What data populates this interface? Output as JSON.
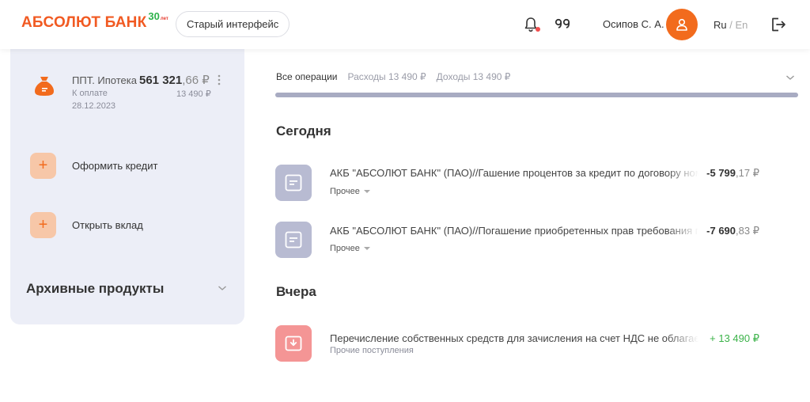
{
  "header": {
    "logo_text": "АБСОЛЮТ БАНК",
    "logo_badge": "30",
    "logo_badge_suffix": "лет",
    "old_ui_label": "Старый интерфейс",
    "user_name": "Осипов С. А.",
    "lang_ru": "Ru",
    "lang_sep": " / ",
    "lang_en": "En"
  },
  "sidebar": {
    "loan": {
      "name": "ППТ. Ипотека",
      "amount_main": "561 321",
      "amount_frac": ",66 ₽",
      "payment_label": "К оплате",
      "payment_date": "28.12.2023",
      "payment_amount": "13 490 ₽"
    },
    "actions": [
      {
        "label": "Оформить кредит"
      },
      {
        "label": "Открыть вклад"
      }
    ],
    "archive_title": "Архивные продукты"
  },
  "operations": {
    "tabs": [
      {
        "label": "Все операции"
      },
      {
        "label": "Расходы 13 490 ₽"
      },
      {
        "label": "Доходы 13 490 ₽"
      }
    ],
    "progress": 1.0,
    "groups": [
      {
        "title": "Сегодня",
        "items": [
          {
            "title": "АКБ \"АБСОЛЮТ БАНК\" (ПАО)//Гашение процентов за кредит по договору ном",
            "category": "Прочее",
            "amount_main": "-5 799",
            "amount_frac": ",17 ₽"
          },
          {
            "title": "АКБ \"АБСОЛЮТ БАНК\" (ПАО)//Погашение приобретенных прав требования по",
            "category": "Прочее",
            "amount_main": "-7 690",
            "amount_frac": ",83 ₽"
          }
        ]
      },
      {
        "title": "Вчера",
        "items": [
          {
            "title": "Перечисление собственных средств для зачисления на счет НДС не облагается",
            "category": "Прочие поступления",
            "amount_main": "+ 13 490",
            "amount_frac": " ₽"
          }
        ]
      }
    ]
  },
  "colors": {
    "brand": "#f15a22",
    "positive": "#3cb34a",
    "panel_bg": "#eceef7"
  },
  "icons": [
    "bell-icon",
    "quotes-icon",
    "user-icon",
    "logout-icon",
    "money-bag-icon",
    "plus-icon",
    "chevron-down-icon",
    "document-icon",
    "inbox-download-icon"
  ]
}
